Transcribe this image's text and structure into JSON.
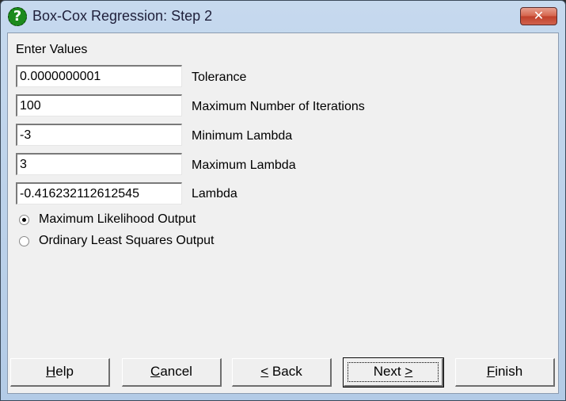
{
  "window": {
    "title": "Box-Cox Regression: Step 2",
    "app_icon": "help-question-icon",
    "close_glyph": "✕"
  },
  "form": {
    "heading": "Enter Values",
    "fields": [
      {
        "value": "0.0000000001",
        "label": "Tolerance"
      },
      {
        "value": "100",
        "label": "Maximum Number of Iterations"
      },
      {
        "value": "-3",
        "label": "Minimum Lambda"
      },
      {
        "value": "3",
        "label": "Maximum Lambda"
      },
      {
        "value": "-0.416232112612545",
        "label": "Lambda"
      }
    ],
    "output_options": [
      {
        "label": "Maximum Likelihood Output",
        "checked": true
      },
      {
        "label": "Ordinary Least Squares Output",
        "checked": false
      }
    ]
  },
  "buttons": {
    "help": {
      "mnemonic": "H",
      "rest": "elp"
    },
    "cancel": {
      "mnemonic": "C",
      "rest": "ancel"
    },
    "back": {
      "mnemonic": "<",
      "rest": " Back"
    },
    "next": {
      "pre": "Next ",
      "mnemonic": ">"
    },
    "finish": {
      "mnemonic": "F",
      "rest": "inish"
    }
  }
}
